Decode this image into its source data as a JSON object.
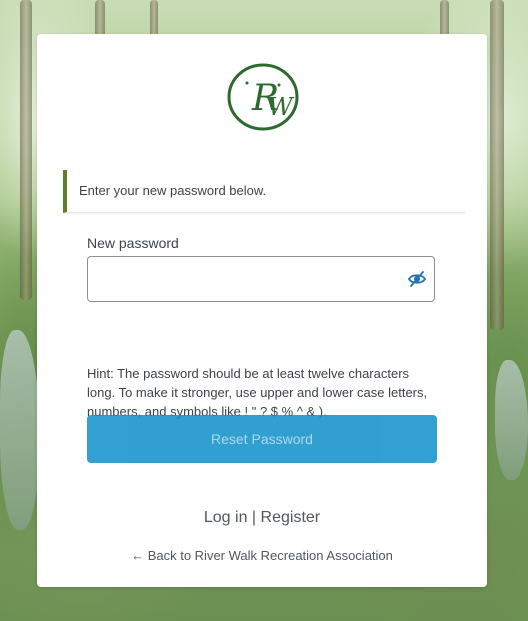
{
  "logo": {
    "letters": "RW",
    "color": "#2d6a2f"
  },
  "notice": {
    "message": "Enter your new password below.",
    "accent_color": "#5f7f2c"
  },
  "form": {
    "new_password_label": "New password",
    "new_password_value": "",
    "visibility_toggle_icon": "eye-slash-icon",
    "hint": "Hint: The password should be at least twelve characters long. To make it stronger, use upper and lower case letters, numbers, and symbols like ! \" ? $ % ^ & ).",
    "submit_label": "Reset Password",
    "submit_color": "#0e90c9"
  },
  "links": {
    "login": "Log in",
    "separator": "|",
    "register": "Register",
    "back": "← Back to River Walk Recreation Association"
  }
}
